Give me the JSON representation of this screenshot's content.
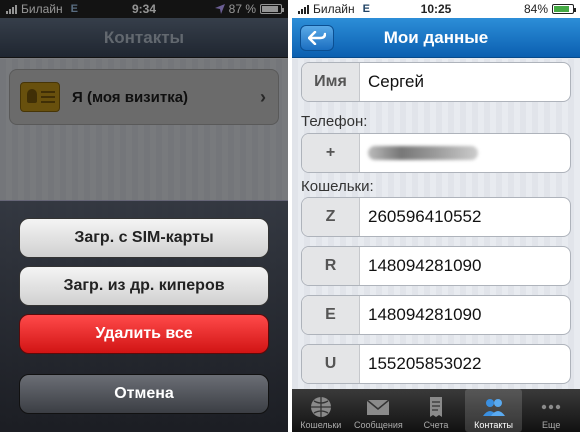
{
  "left": {
    "status": {
      "carrier": "Билайн",
      "network": "E",
      "time": "9:34",
      "battery_text": "87 %",
      "battery_level": 0.87
    },
    "navbar": {
      "title": "Контакты"
    },
    "card": {
      "label": "Я (моя визитка)",
      "icon": "business-card-icon",
      "chevron": "›"
    },
    "sheet": {
      "buttons": [
        {
          "label": "Загр. с SIM-карты"
        },
        {
          "label": "Загр. из др. киперов"
        },
        {
          "label": "Удалить все"
        },
        {
          "label": "Отмена"
        }
      ]
    }
  },
  "right": {
    "status": {
      "carrier": "Билайн",
      "network": "E",
      "time": "10:25",
      "battery_text": "84%",
      "battery_level": 0.84
    },
    "navbar": {
      "title": "Мои данные",
      "back_icon": "back-arrow-icon"
    },
    "name": {
      "key": "Имя",
      "value": "Сергей"
    },
    "phone_label": "Телефон:",
    "phone": {
      "key": "+"
    },
    "wallets_label": "Кошельки:",
    "wallets": [
      {
        "key": "Z",
        "value": "260596410552"
      },
      {
        "key": "R",
        "value": "148094281090"
      },
      {
        "key": "E",
        "value": "148094281090"
      },
      {
        "key": "U",
        "value": "155205853022"
      }
    ],
    "tabs": [
      {
        "label": "Кошельки",
        "icon": "globe-icon"
      },
      {
        "label": "Сообщения",
        "icon": "envelope-icon"
      },
      {
        "label": "Счета",
        "icon": "receipt-icon"
      },
      {
        "label": "Контакты",
        "icon": "contacts-icon",
        "active": true
      },
      {
        "label": "Еще",
        "icon": "more-icon"
      }
    ]
  },
  "colors": {
    "accent": "#1a76c8",
    "destructive": "#e02020"
  }
}
